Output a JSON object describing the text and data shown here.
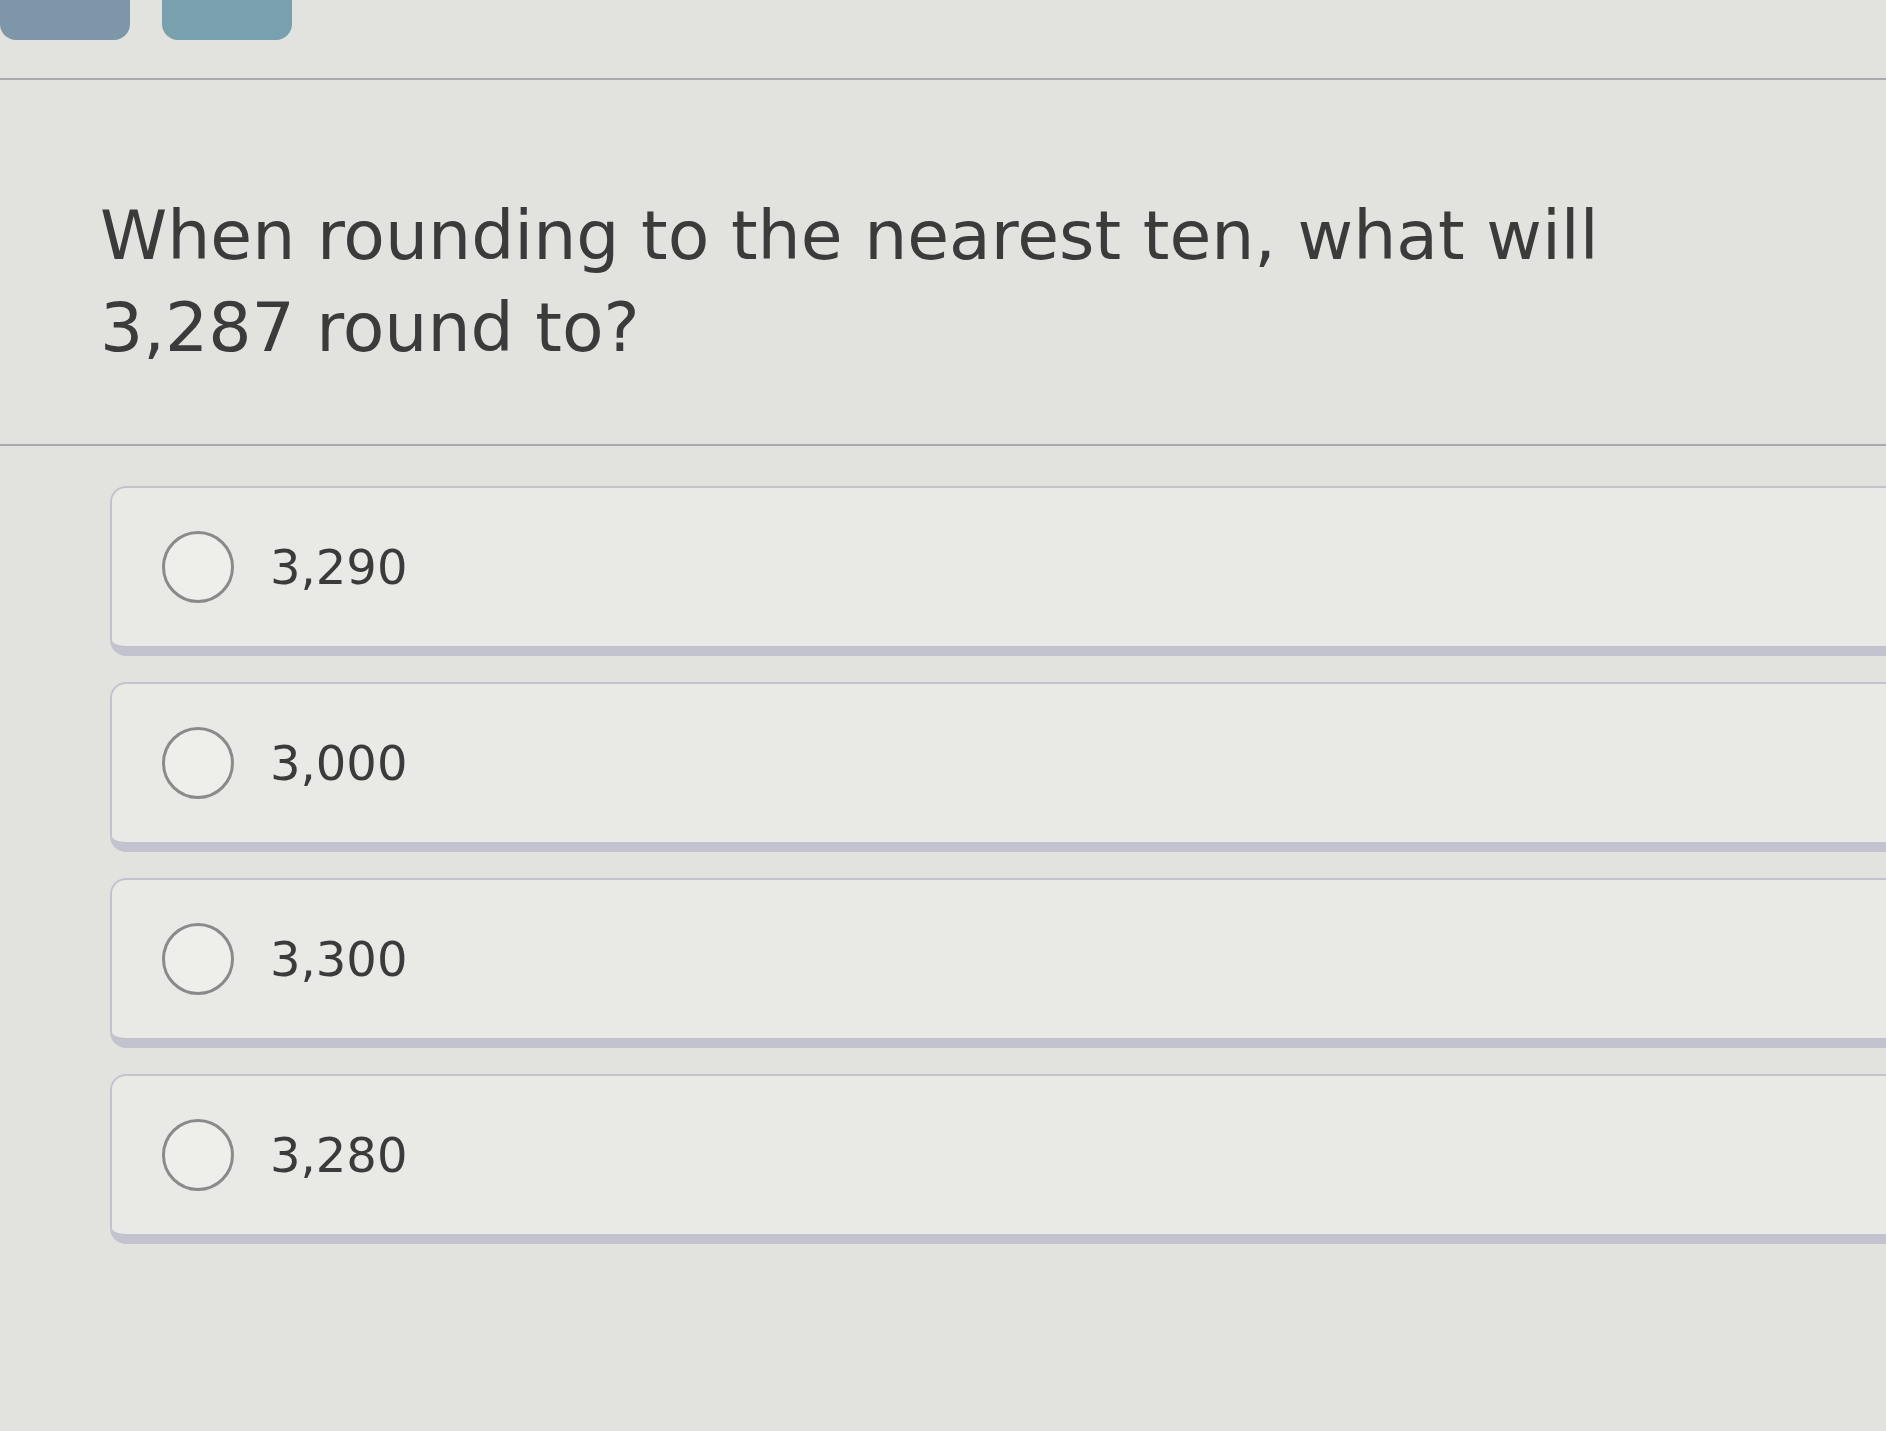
{
  "question": {
    "text": "When rounding to the nearest ten, what will 3,287 round to?"
  },
  "options": [
    {
      "label": "3,290",
      "selected": false
    },
    {
      "label": "3,000",
      "selected": false
    },
    {
      "label": "3,300",
      "selected": false
    },
    {
      "label": "3,280",
      "selected": false
    }
  ]
}
